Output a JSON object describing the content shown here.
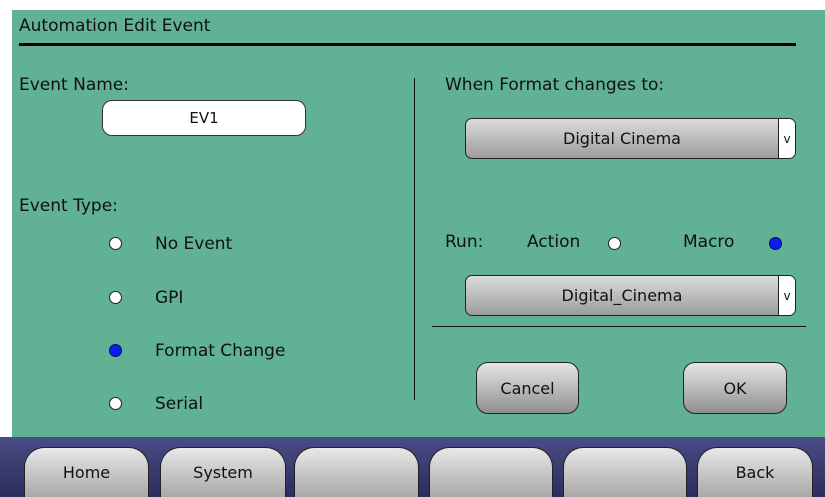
{
  "window": {
    "title": "Automation Edit Event"
  },
  "event_name": {
    "label": "Event Name:",
    "value": "EV1"
  },
  "event_type": {
    "label": "Event Type:",
    "options": [
      {
        "label": "No Event",
        "selected": false
      },
      {
        "label": "GPI",
        "selected": false
      },
      {
        "label": "Format Change",
        "selected": true
      },
      {
        "label": "Serial",
        "selected": false
      }
    ]
  },
  "format": {
    "label": "When Format changes to:",
    "selected": "Digital Cinema",
    "arrow": "v"
  },
  "run": {
    "label": "Run:",
    "action_label": "Action",
    "action_selected": false,
    "macro_label": "Macro",
    "macro_selected": true,
    "selected": "Digital_Cinema",
    "arrow": "v"
  },
  "buttons": {
    "cancel": "Cancel",
    "ok": "OK"
  },
  "nav": {
    "home": "Home",
    "system": "System",
    "blank1": "",
    "blank2": "",
    "blank3": "",
    "back": "Back"
  },
  "colors": {
    "panel": "#61b194",
    "radio_selected": "#0a1ef0",
    "navbar": "#3a3c72"
  }
}
